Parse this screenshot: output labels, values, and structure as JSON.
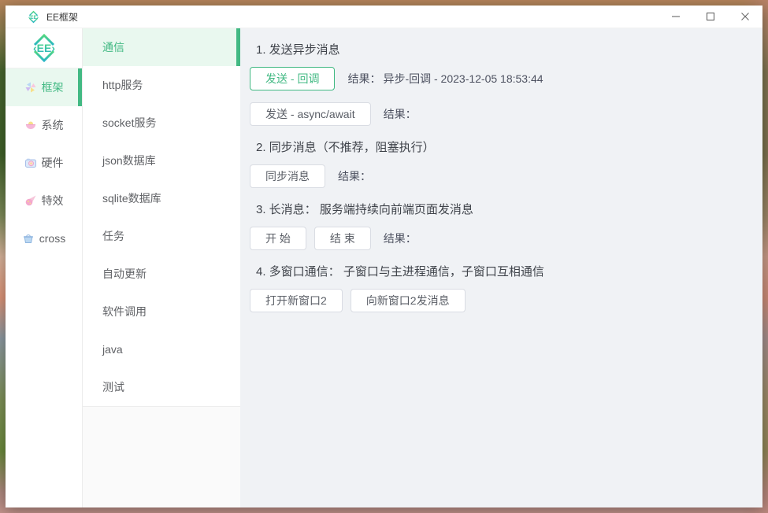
{
  "window": {
    "title": "EE框架"
  },
  "logo": {
    "text": "‹EE›"
  },
  "titlebar": {
    "controls": [
      {
        "name": "minimize"
      },
      {
        "name": "maximize"
      },
      {
        "name": "close"
      }
    ]
  },
  "colors": {
    "accent": "#42b983",
    "accent_light_bg": "#e9f8ef",
    "main_bg": "#f0f2f5",
    "sidebar_bg": "#ffffff",
    "button_border": "#d9dce3",
    "text_primary": "#3f434a",
    "text_secondary": "#606266"
  },
  "sidebar_primary": {
    "items": [
      {
        "label": "框架",
        "icon": "pinwheel-icon",
        "active": true
      },
      {
        "label": "系统",
        "icon": "bowl-icon",
        "active": false
      },
      {
        "label": "硬件",
        "icon": "camera-icon",
        "active": false
      },
      {
        "label": "特效",
        "icon": "comet-icon",
        "active": false
      },
      {
        "label": "cross",
        "icon": "basket-icon",
        "active": false
      }
    ]
  },
  "sidebar_secondary": {
    "items": [
      {
        "label": "通信",
        "active": true
      },
      {
        "label": "http服务",
        "active": false
      },
      {
        "label": "socket服务",
        "active": false
      },
      {
        "label": "json数据库",
        "active": false
      },
      {
        "label": "sqlite数据库",
        "active": false
      },
      {
        "label": "任务",
        "active": false
      },
      {
        "label": "自动更新",
        "active": false
      },
      {
        "label": "软件调用",
        "active": false
      },
      {
        "label": "java",
        "active": false
      },
      {
        "label": "测试",
        "active": false
      }
    ]
  },
  "main": {
    "sections": [
      {
        "heading": "1. 发送异步消息",
        "rows": [
          {
            "buttons": [
              {
                "label": "发送 - 回调",
                "variant": "success"
              }
            ],
            "result_label": "结果：",
            "result_value": "异步-回调 - 2023-12-05 18:53:44"
          },
          {
            "buttons": [
              {
                "label": "发送 - async/await",
                "variant": "default"
              }
            ],
            "result_label": "结果：",
            "result_value": ""
          }
        ]
      },
      {
        "heading": "2. 同步消息（不推荐，阻塞执行）",
        "rows": [
          {
            "buttons": [
              {
                "label": "同步消息",
                "variant": "default"
              }
            ],
            "result_label": "结果：",
            "result_value": ""
          }
        ]
      },
      {
        "heading": "3. 长消息： 服务端持续向前端页面发消息",
        "rows": [
          {
            "buttons": [
              {
                "label": "开 始",
                "variant": "default"
              },
              {
                "label": "结 束",
                "variant": "default"
              }
            ],
            "result_label": "结果：",
            "result_value": ""
          }
        ]
      },
      {
        "heading": "4. 多窗口通信： 子窗口与主进程通信，子窗口互相通信",
        "rows": [
          {
            "buttons": [
              {
                "label": "打开新窗口2",
                "variant": "default"
              },
              {
                "label": "向新窗口2发消息",
                "variant": "default"
              }
            ],
            "result_label": "",
            "result_value": ""
          }
        ]
      }
    ]
  }
}
